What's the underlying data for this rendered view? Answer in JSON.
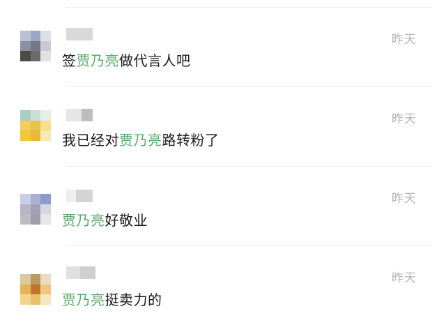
{
  "comments": [
    {
      "username": "",
      "mention": "贾乃亮",
      "text_before": "签",
      "text_after": "做代言人吧",
      "time": "昨天",
      "avatar_colors": [
        "#b9c1d6",
        "#9aa8c7",
        "#dbe0ea",
        "#8c8fa0",
        "#747886",
        "#c8cbd4",
        "#4f4a4a",
        "#6f6a6a",
        "#e2e2e6"
      ]
    },
    {
      "username": "",
      "mention": "贾乃亮",
      "text_before": "我已经对",
      "text_after": "路转粉了",
      "time": "昨天",
      "avatar_colors": [
        "#a8cfc4",
        "#c9e0d5",
        "#e6eee9",
        "#f0cf5a",
        "#e7c24d",
        "#f6df86",
        "#f3c63b",
        "#e9b93a",
        "#f5e9b8"
      ]
    },
    {
      "username": "",
      "mention": "贾乃亮",
      "text_before": "",
      "text_after": "好敬业",
      "time": "昨天",
      "avatar_colors": [
        "#c9cde6",
        "#a7afd8",
        "#8f9acc",
        "#b7b5c6",
        "#a39fb5",
        "#d7d6de",
        "#bcbcc4",
        "#9e9ea8",
        "#e5e5ea"
      ]
    },
    {
      "username": "",
      "mention": "贾乃亮",
      "text_before": "",
      "text_after": "挺卖力的",
      "time": "昨天",
      "avatar_colors": [
        "#d8c9a3",
        "#b89a62",
        "#e8dcc0",
        "#e6b35a",
        "#c0742e",
        "#f0c77a",
        "#f2d68e",
        "#e9c06a",
        "#f6e7c2"
      ]
    }
  ],
  "colors": {
    "mention": "#58a86a",
    "time": "#b3b3b3",
    "text": "#1a1a1a",
    "divider": "#ececec"
  }
}
